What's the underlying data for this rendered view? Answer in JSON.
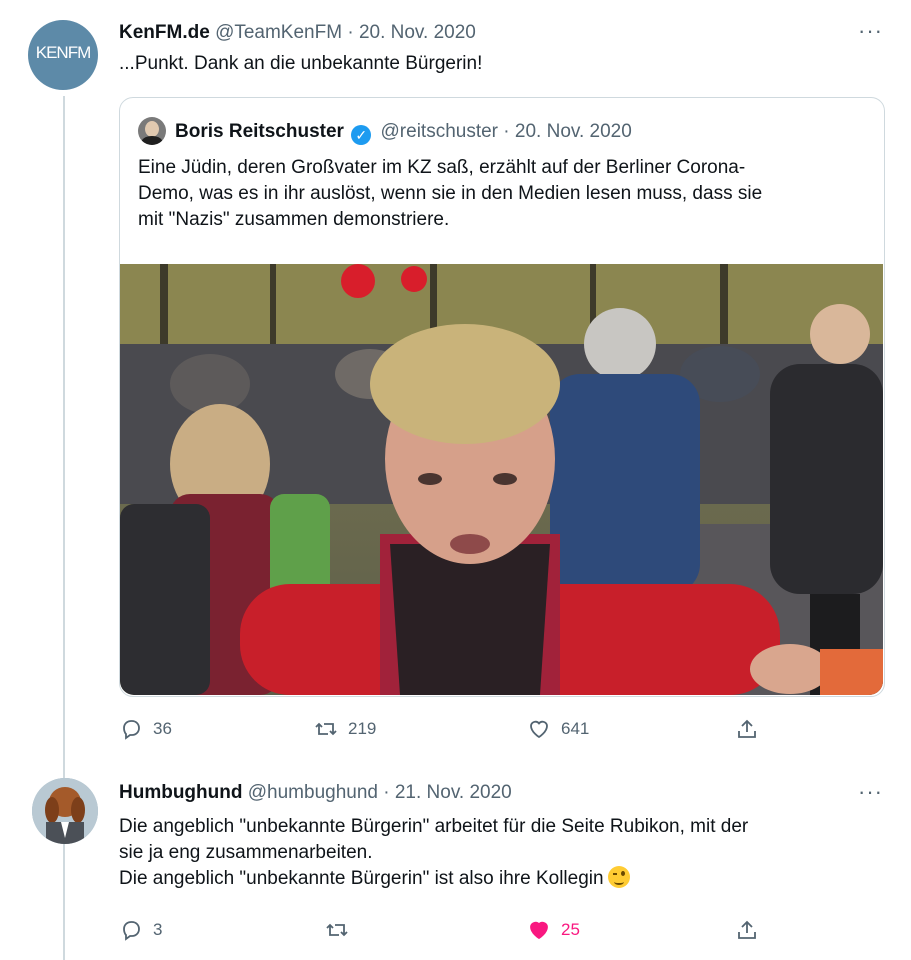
{
  "tweet1": {
    "avatar_text": "KENFM",
    "name": "KenFM.de",
    "handle": "@TeamKenFM",
    "dot": "·",
    "date": "20. Nov. 2020",
    "more": "···",
    "text": "...Punkt. Dank an die unbekannte Bürgerin!",
    "quoted": {
      "name": "Boris Reitschuster",
      "verified_glyph": "✓",
      "handle": "@reitschuster",
      "dot": "·",
      "date": "20. Nov. 2020",
      "text_line1": "Eine Jüdin, deren Großvater im KZ saß, erzählt auf der Berliner Corona-",
      "text_line2": "Demo, was es in ihr auslöst, wenn sie in den Medien lesen muss, dass sie",
      "text_line3": "mit \"Nazis\" zusammen demonstriere."
    },
    "actions": {
      "replies": "36",
      "retweets": "219",
      "likes": "641"
    }
  },
  "tweet2": {
    "name": "Humbughund",
    "handle": "@humbughund",
    "dot": "·",
    "date": "21. Nov. 2020",
    "more": "···",
    "text_line1": "Die angeblich \"unbekannte Bürgerin\" arbeitet für die Seite Rubikon, mit der",
    "text_line2": "sie ja eng zusammenarbeiten.",
    "text_line3": "Die angeblich \"unbekannte Bürgerin\" ist also ihre Kollegin",
    "emoji": "winking-face",
    "actions": {
      "replies": "3",
      "retweets": "",
      "likes": "25",
      "liked": true
    }
  },
  "colors": {
    "text": "#0f1419",
    "secondary": "#536471",
    "border": "#cfd9de",
    "verified": "#1d9bf0",
    "like": "#f91880"
  }
}
